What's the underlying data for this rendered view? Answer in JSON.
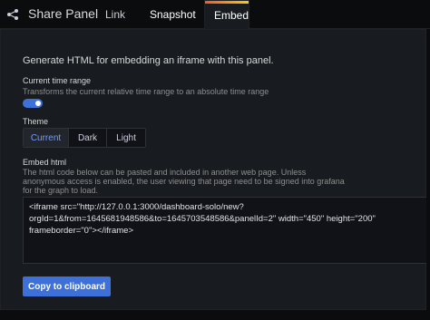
{
  "header": {
    "title": "Share Panel",
    "tabs": [
      {
        "label": "Link"
      },
      {
        "label": "Snapshot"
      },
      {
        "label": "Embed",
        "active": true
      }
    ]
  },
  "embed": {
    "intro": "Generate HTML for embedding an iframe with this panel.",
    "time_range": {
      "label": "Current time range",
      "description": "Transforms the current relative time range to an absolute time range",
      "enabled": true
    },
    "theme": {
      "label": "Theme",
      "options": [
        "Current",
        "Dark",
        "Light"
      ],
      "selected": "Current"
    },
    "embed_html": {
      "label": "Embed html",
      "description_lines": [
        "The html code below can be pasted and included in another web page. Unless",
        "anonymous access is enabled, the user viewing that page need to be signed into grafana",
        "for the graph to load."
      ],
      "code_lines": [
        "<iframe src=\"http://127.0.0.1:3000/dashboard-solo/new?",
        "orgId=1&from=1645681948586&to=1645703548586&panelId=2\" width=\"450\" height=\"200\"",
        "frameborder=\"0\"></iframe>"
      ]
    },
    "copy_button_label": "Copy to clipboard"
  },
  "colors": {
    "accent": "#3d71d9",
    "active_tab_gradient": [
      "#f05a28",
      "#fbca0a"
    ],
    "selected_option_text": "#6e9fff"
  }
}
